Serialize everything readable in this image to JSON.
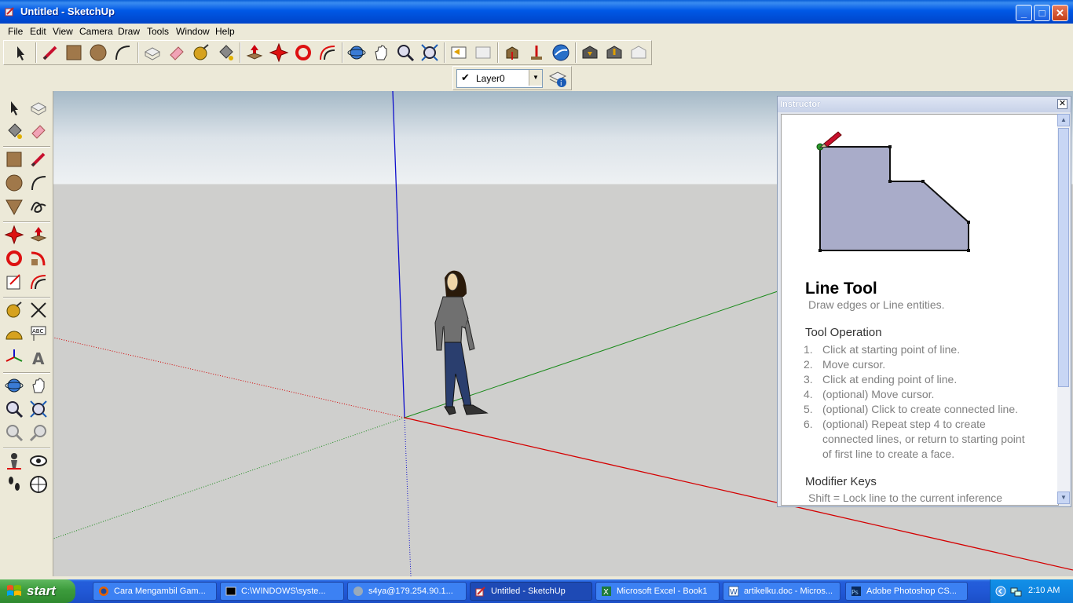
{
  "window": {
    "title": "Untitled - SketchUp",
    "minimize_label": "_",
    "maximize_label": "□",
    "close_label": "✕"
  },
  "menu": [
    "File",
    "Edit",
    "View",
    "Camera",
    "Draw",
    "Tools",
    "Window",
    "Help"
  ],
  "toolbar": {
    "buttons": [
      "select-icon",
      "line-icon",
      "rectangle-icon",
      "circle-icon",
      "arc-icon",
      "make-component-icon",
      "eraser-icon",
      "tape-measure-icon",
      "paint-bucket-icon",
      "push-pull-icon",
      "move-icon",
      "rotate-icon",
      "offset-icon",
      "orbit-icon",
      "pan-icon",
      "zoom-icon",
      "zoom-extents-icon",
      "previous-view-icon",
      "next-view-icon",
      "get-models-icon",
      "share-model-icon",
      "google-earth-icon",
      "get-current-view-icon",
      "toggle-terrain-icon",
      "place-model-icon"
    ]
  },
  "layers": {
    "current": "Layer0",
    "checkmark": "✔"
  },
  "left_toolbar": {
    "buttons": [
      "select-icon",
      "make-component-icon",
      "paint-bucket-icon",
      "eraser-icon",
      "rectangle-icon",
      "line-icon",
      "circle-icon",
      "arc-icon",
      "polygon-icon",
      "freehand-icon",
      "move-icon",
      "push-pull-icon",
      "rotate-icon",
      "follow-me-icon",
      "scale-icon",
      "offset-icon",
      "tape-measure-icon",
      "dimension-icon",
      "protractor-icon",
      "text-icon",
      "axes-icon",
      "3d-text-icon",
      "orbit-icon",
      "pan-icon",
      "zoom-icon",
      "zoom-extents-icon",
      "previous-view-icon",
      "next-view-icon",
      "position-camera-icon",
      "look-around-icon",
      "walk-icon",
      "section-plane-icon"
    ]
  },
  "instructor": {
    "title": "Instructor",
    "close": "✕",
    "tool_name": "Line Tool",
    "tool_desc": "Draw edges or Line entities.",
    "operation_heading": "Tool Operation",
    "steps": [
      {
        "n": "1.",
        "text": "Click at starting point of line."
      },
      {
        "n": "2.",
        "text": "Move cursor."
      },
      {
        "n": "3.",
        "text": "Click at ending point of line."
      },
      {
        "n": "4.",
        "text": "(optional) Move cursor."
      },
      {
        "n": "5.",
        "text": "(optional) Click to create connected line."
      },
      {
        "n": "6.",
        "text": "(optional) Repeat step 4 to create connected lines, or return to starting point of first line to create a face."
      }
    ],
    "modifier_heading": "Modifier Keys",
    "modifier_text": "Shift = Lock line to the current inference"
  },
  "taskbar": {
    "start": "start",
    "tasks": [
      {
        "label": "Cara Mengambil Gam...",
        "icon": "firefox-icon"
      },
      {
        "label": "C:\\WINDOWS\\syste...",
        "icon": "cmd-icon"
      },
      {
        "label": "s4ya@179.254.90.1...",
        "icon": "chat-icon"
      },
      {
        "label": "Untitled - SketchUp",
        "icon": "sketchup-icon",
        "active": true
      },
      {
        "label": "Microsoft Excel - Book1",
        "icon": "excel-icon"
      },
      {
        "label": "artikelku.doc - Micros...",
        "icon": "word-icon"
      },
      {
        "label": "Adobe Photoshop CS...",
        "icon": "photoshop-icon"
      }
    ],
    "clock": "2:10 AM"
  },
  "colors": {
    "titlebar": "#0058e6",
    "red_axis": "#d40000",
    "green_axis": "#1a8a1a",
    "blue_axis": "#1010cc",
    "face_fill": "#a9acc9"
  }
}
